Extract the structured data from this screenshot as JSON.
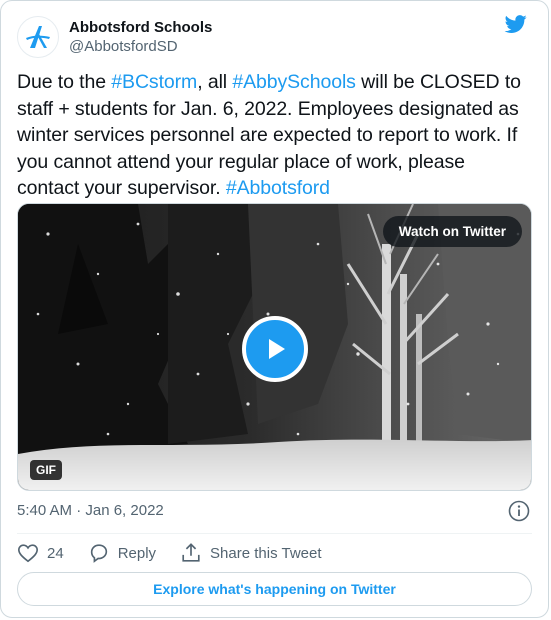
{
  "account": {
    "display_name": "Abbotsford Schools",
    "handle": "@AbbotsfordSD",
    "avatar_icon": "abbotsford-logo-icon",
    "brand_icon": "twitter-bird-icon"
  },
  "tweet": {
    "text_parts": [
      {
        "type": "text",
        "value": "Due to the "
      },
      {
        "type": "hashtag",
        "value": "#BCstorm"
      },
      {
        "type": "text",
        "value": ", all "
      },
      {
        "type": "hashtag",
        "value": "#AbbySchools"
      },
      {
        "type": "text",
        "value": " will be CLOSED to staff + students for Jan. 6, 2022. Employees designated as winter services personnel are expected to report to work. If you cannot attend your regular place of work, please contact your supervisor. "
      },
      {
        "type": "hashtag",
        "value": "#Abbotsford"
      }
    ],
    "timestamp": "5:40 AM · Jan 6, 2022"
  },
  "media": {
    "watch_label": "Watch on Twitter",
    "badge": "GIF",
    "play_icon": "play-icon"
  },
  "actions": {
    "like_count": "24",
    "reply_label": "Reply",
    "share_label": "Share this Tweet"
  },
  "footer": {
    "explore_label": "Explore what's happening on Twitter"
  },
  "colors": {
    "accent": "#1d9bf0",
    "text": "#0f1419",
    "muted": "#536471",
    "border": "#cfd9de"
  }
}
